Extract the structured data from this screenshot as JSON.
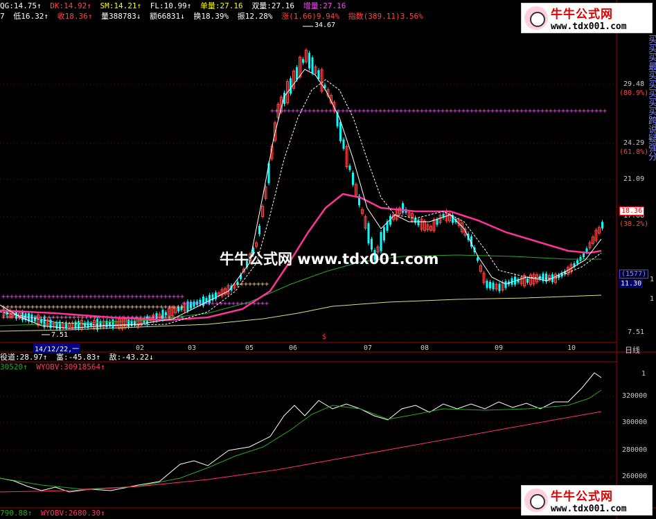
{
  "indicator_row1": {
    "qg": "QG:14.75↑",
    "dk": "DK:14.92↑",
    "sm": "SM:14.21↑",
    "fl": "FL:10.99↑",
    "single_vol": "单量:27.16",
    "double_vol": "双量:27.16",
    "add_vol": "增量:27.16"
  },
  "indicator_row2": {
    "prefix": "7",
    "low": "低16.32↑",
    "close": "收18.36↑",
    "volume": "量388783↓",
    "amount": "额66831↓",
    "turnover": "换18.39%",
    "amplitude": "振12.28%",
    "change": "涨(1.66)9.94%",
    "index": "指数(389.11)3.56%"
  },
  "price_axis": {
    "high_label": "34.67",
    "low_label": "7.51",
    "ticks": [
      "29.48",
      "(80.9%)",
      "24.29",
      "(61.8%)",
      "21.09",
      "17.68",
      "(38.2%)",
      "(1577)",
      "11.30",
      "1",
      "1",
      "7.51"
    ],
    "current_price": "18.36",
    "hl_prices": [
      "29.48",
      "24.29",
      "21.09",
      "17.68"
    ],
    "percent_levels": [
      "(80.9%)",
      "(61.8%)",
      "(38.2%)"
    ]
  },
  "x_axis": {
    "date_label": "14/12/22,一",
    "months": [
      "02",
      "03",
      "05",
      "06",
      "07",
      "08",
      "09",
      "10"
    ],
    "period_label": "日线",
    "marker": "$"
  },
  "sub_indicator_row": {
    "a": "役道:28.97↑",
    "b": "富:-45.83↑",
    "c": "敌:-43.22↓"
  },
  "obv_row": {
    "a": "30520↑",
    "b": "WYOBV:30918564↑"
  },
  "obv_axis": [
    "1",
    "320000",
    "300000",
    "280000",
    "260000"
  ],
  "bottom_row": {
    "a": "790.88↑",
    "b": "WYOBV:2680.30↑"
  },
  "right_strip": {
    "text": "买买买最买买买买买跨说疑强分"
  },
  "watermark": "牛牛公式网 www.tdx001.com",
  "banner_top": {
    "title": "牛牛公式网",
    "url": "www.tdx001.com"
  },
  "banner_bottom": {
    "title": "牛牛公式网",
    "url": "www.tdx001.com"
  },
  "colors": {
    "background": "#000000",
    "up_candle": "#ff4444",
    "down_candle": "#00ffff",
    "ma_pink": "#ff3399",
    "ma_green": "#22aa22",
    "ma_yellow": "#dddd88",
    "line_white": "#ffffff",
    "magenta_level": "#ff44ff",
    "grid_red": "#8b0000"
  }
}
